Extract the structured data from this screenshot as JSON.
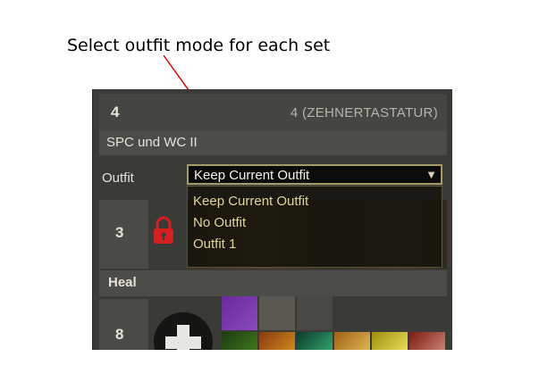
{
  "annotation": {
    "text": "Select outfit mode for each set"
  },
  "header": {
    "number": "4",
    "keybind": "4 (ZEHNERTASTATUR)"
  },
  "set": {
    "name": "SPC und WC II"
  },
  "outfit": {
    "label": "Outfit",
    "selected": "Keep Current Outfit",
    "options": [
      "Keep Current Outfit",
      "No Outfit",
      "Outfit 1"
    ]
  },
  "gear_slot": {
    "number": "3",
    "icon": "lock-icon"
  },
  "heal_set": {
    "name": "Heal",
    "number": "8",
    "icon": "heal-cross-icon"
  },
  "colors": {
    "panel": "#3a3a37",
    "row": "#4a4a46",
    "accent": "#a69a68",
    "lock": "#d42020",
    "arrow": "#e00000"
  }
}
